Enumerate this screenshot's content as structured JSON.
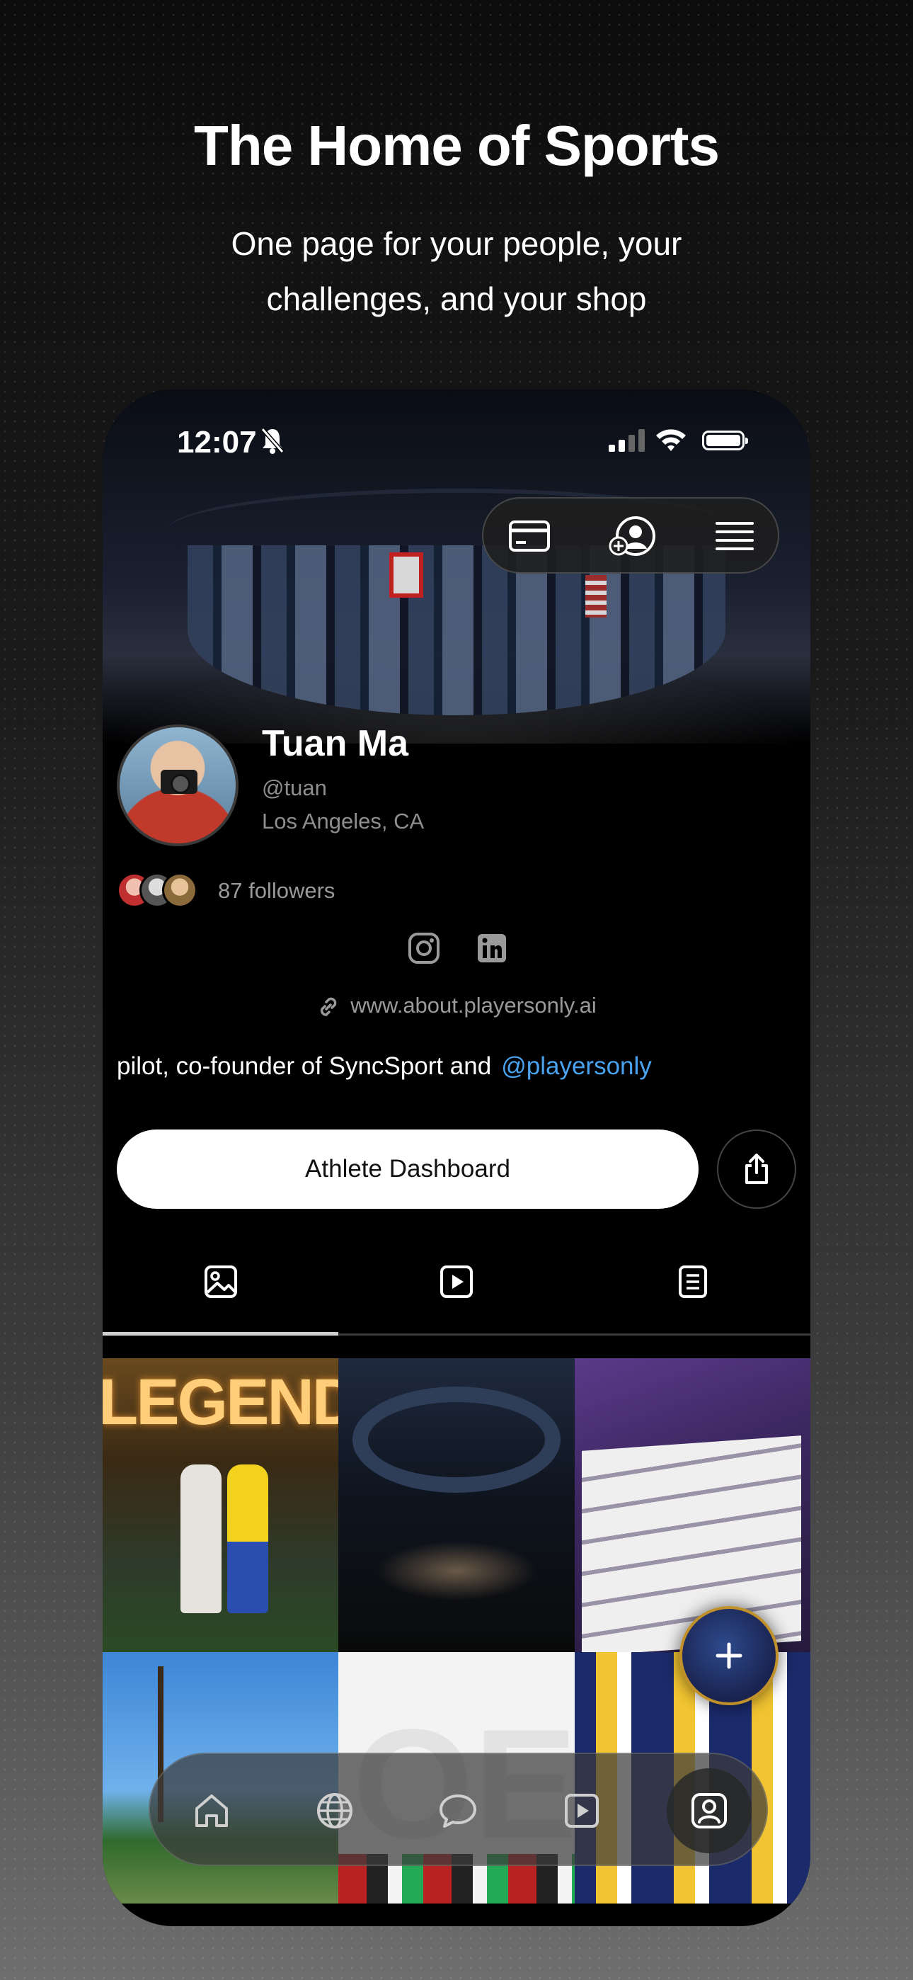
{
  "promo": {
    "headline": "The Home of Sports",
    "subline_1": "One page for your people, your",
    "subline_2": "challenges, and your shop"
  },
  "status_bar": {
    "time": "12:07",
    "icons": [
      "bell-slash-icon",
      "cellular-signal-icon",
      "wifi-icon",
      "battery-icon"
    ]
  },
  "top_actions": {
    "icons": [
      "card-icon",
      "add-user-icon",
      "menu-icon"
    ]
  },
  "profile": {
    "name": "Tuan Ma",
    "handle": "@tuan",
    "location": "Los Angeles, CA",
    "followers": "87 followers",
    "socials": [
      "instagram-icon",
      "linkedin-icon"
    ],
    "website": "www.about.playersonly.ai",
    "bio_text": "pilot, co-founder of SyncSport and",
    "bio_mention": "@playersonly"
  },
  "actions": {
    "dashboard_label": "Athlete Dashboard",
    "share_icon": "share-icon"
  },
  "tabs": [
    {
      "icon": "photo-icon",
      "active": true
    },
    {
      "icon": "video-icon",
      "active": false
    },
    {
      "icon": "document-icon",
      "active": false
    }
  ],
  "grid": {
    "tile_1_text": "LEGENDS"
  },
  "bottom_nav": {
    "items": [
      "home-icon",
      "globe-icon",
      "chat-icon",
      "play-icon",
      "profile-icon"
    ],
    "active": "profile-icon"
  },
  "colors": {
    "accent_link": "#4aa3f0",
    "fab_ring": "#c0902a"
  }
}
